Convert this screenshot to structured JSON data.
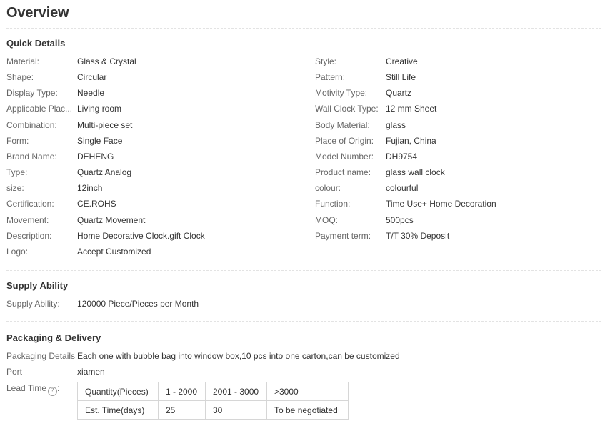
{
  "overview": {
    "title": "Overview"
  },
  "quick_details": {
    "title": "Quick Details",
    "left": [
      {
        "label": "Material:",
        "value": "Glass & Crystal"
      },
      {
        "label": "Shape:",
        "value": "Circular"
      },
      {
        "label": "Display Type:",
        "value": "Needle"
      },
      {
        "label": "Applicable Plac...",
        "value": "Living room"
      },
      {
        "label": "Combination:",
        "value": "Multi-piece set"
      },
      {
        "label": "Form:",
        "value": "Single Face"
      },
      {
        "label": "Brand Name:",
        "value": "DEHENG"
      },
      {
        "label": "Type:",
        "value": "Quartz Analog"
      },
      {
        "label": "size:",
        "value": "12inch"
      },
      {
        "label": "Certification:",
        "value": "CE.ROHS"
      },
      {
        "label": "Movement:",
        "value": "Quartz Movement"
      },
      {
        "label": "Description:",
        "value": "Home Decorative Clock.gift Clock"
      },
      {
        "label": "Logo:",
        "value": "Accept Customized"
      }
    ],
    "right": [
      {
        "label": "Style:",
        "value": "Creative"
      },
      {
        "label": "Pattern:",
        "value": "Still Life"
      },
      {
        "label": "Motivity Type:",
        "value": "Quartz"
      },
      {
        "label": "Wall Clock Type:",
        "value": "12 mm Sheet"
      },
      {
        "label": "Body Material:",
        "value": "glass"
      },
      {
        "label": "Place of Origin:",
        "value": "Fujian, China"
      },
      {
        "label": "Model Number:",
        "value": "DH9754"
      },
      {
        "label": "Product name:",
        "value": "glass wall clock"
      },
      {
        "label": "colour:",
        "value": "colourful"
      },
      {
        "label": "Function:",
        "value": "Time Use+ Home Decoration"
      },
      {
        "label": "MOQ:",
        "value": "500pcs"
      },
      {
        "label": "Payment term:",
        "value": "T/T 30% Deposit"
      }
    ]
  },
  "supply_ability": {
    "title": "Supply Ability",
    "label": "Supply Ability:",
    "value": "120000 Piece/Pieces per Month"
  },
  "packaging": {
    "title": "Packaging & Delivery",
    "details_label": "Packaging Details",
    "details_value": "Each one with bubble bag into window box,10 pcs into one carton,can be customized",
    "port_label": "Port",
    "port_value": "xiamen",
    "lead_time_label": "Lead Time",
    "help_icon": "?",
    "lead_table": [
      [
        "Quantity(Pieces)",
        "1 - 2000",
        "2001 - 3000",
        ">3000"
      ],
      [
        "Est. Time(days)",
        "25",
        "30",
        "To be negotiated"
      ]
    ]
  }
}
